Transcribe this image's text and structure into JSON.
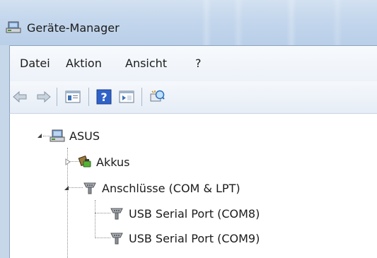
{
  "window": {
    "title": "Geräte-Manager",
    "title_icon": "device-manager-icon"
  },
  "menu": {
    "items": [
      "Datei",
      "Aktion",
      "Ansicht",
      "?"
    ]
  },
  "toolbar": {
    "buttons": [
      "back-arrow-icon",
      "forward-arrow-icon",
      "properties-pane-icon",
      "help-icon",
      "view-pane-icon",
      "scan-hardware-icon"
    ]
  },
  "tree": {
    "root": {
      "label": "ASUS",
      "icon": "computer-icon",
      "expanded": true
    },
    "children": [
      {
        "label": "Akkus",
        "icon": "battery-icon",
        "expanded": false
      },
      {
        "label": "Anschlüsse (COM & LPT)",
        "icon": "port-icon",
        "expanded": true,
        "children": [
          {
            "label": "USB Serial Port (COM8)",
            "icon": "port-icon"
          },
          {
            "label": "USB Serial Port (COM9)",
            "icon": "port-icon"
          }
        ]
      }
    ]
  }
}
